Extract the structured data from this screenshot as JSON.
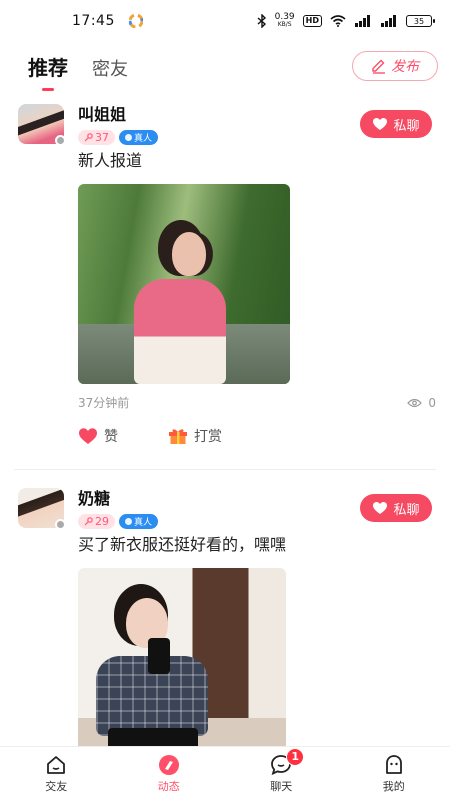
{
  "status_bar": {
    "time": "17:45",
    "net_speed_value": "0.39",
    "net_speed_unit": "KB/S",
    "hd_label": "HD",
    "battery": "35"
  },
  "header": {
    "tabs": [
      {
        "label": "推荐",
        "active": true
      },
      {
        "label": "密友",
        "active": false
      }
    ],
    "publish_label": "发布"
  },
  "posts": [
    {
      "username": "叫姐姐",
      "level": "37",
      "real_badge": "真人",
      "chat_label": "私聊",
      "text": "新人报道",
      "time_ago": "37分钟前",
      "views": "0",
      "like_label": "赞",
      "reward_label": "打赏"
    },
    {
      "username": "奶糖",
      "level": "29",
      "real_badge": "真人",
      "chat_label": "私聊",
      "text": "买了新衣服还挺好看的，嘿嘿"
    }
  ],
  "bottom_nav": {
    "items": [
      {
        "label": "交友",
        "icon": "home-icon",
        "active": false
      },
      {
        "label": "动态",
        "icon": "feed-icon",
        "active": true
      },
      {
        "label": "聊天",
        "icon": "chat-icon",
        "active": false,
        "badge": "1"
      },
      {
        "label": "我的",
        "icon": "profile-icon",
        "active": false
      }
    ]
  },
  "colors": {
    "accent": "#ff4f6b",
    "chat_button": "#f64a62",
    "real_badge": "#2b8cf2",
    "level_badge_bg": "#ffe1e6"
  }
}
